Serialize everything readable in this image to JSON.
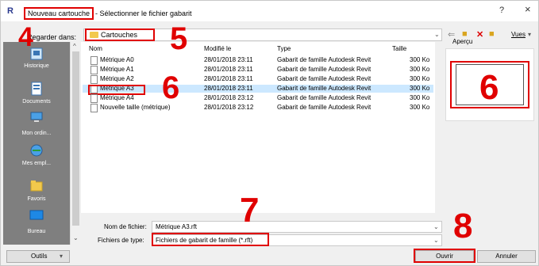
{
  "titlebar": {
    "app_icon": "R",
    "title_highlighted": "Nouveau cartouche",
    "title_rest": "- Sélectionner le fichier gabarit",
    "help": "?",
    "close": "×"
  },
  "lookin": {
    "label": "Regarder dans:",
    "value": "Cartouches"
  },
  "toolbar": {
    "views_label": "Vues",
    "icons": [
      "back-arrow-icon",
      "up-folder-icon",
      "delete-icon",
      "new-folder-icon"
    ]
  },
  "preview": {
    "label": "Aperçu"
  },
  "sidebar": {
    "items": [
      {
        "label": "Historique",
        "icon": "history-icon"
      },
      {
        "label": "Documents",
        "icon": "documents-icon"
      },
      {
        "label": "Mon ordin...",
        "icon": "computer-icon"
      },
      {
        "label": "Mes empl...",
        "icon": "network-icon"
      },
      {
        "label": "Favoris",
        "icon": "favorites-icon"
      },
      {
        "label": "Bureau",
        "icon": "desktop-icon"
      }
    ]
  },
  "file_list": {
    "columns": [
      "Nom",
      "Modifié le",
      "Type",
      "Taille"
    ],
    "rows": [
      {
        "name": "Métrique A0",
        "date": "28/01/2018 23:11",
        "type": "Gabarit de famille Autodesk Revit",
        "size": "300 Ko"
      },
      {
        "name": "Métrique A1",
        "date": "28/01/2018 23:11",
        "type": "Gabarit de famille Autodesk Revit",
        "size": "300 Ko"
      },
      {
        "name": "Métrique A2",
        "date": "28/01/2018 23:11",
        "type": "Gabarit de famille Autodesk Revit",
        "size": "300 Ko"
      },
      {
        "name": "Métrique A3",
        "date": "28/01/2018 23:11",
        "type": "Gabarit de famille Autodesk Revit",
        "size": "300 Ko"
      },
      {
        "name": "Métrique A4",
        "date": "28/01/2018 23:12",
        "type": "Gabarit de famille Autodesk Revit",
        "size": "300 Ko"
      },
      {
        "name": "Nouvelle taille (métrique)",
        "date": "28/01/2018 23:12",
        "type": "Gabarit de famille Autodesk Revit",
        "size": "300 Ko"
      }
    ],
    "selected_row": 3
  },
  "filename": {
    "label": "Nom de fichier:",
    "value": "Métrique A3.rft"
  },
  "filetype": {
    "label": "Fichiers de type:",
    "value": "Fichiers de gabarit de famille  (*.rft)"
  },
  "buttons": {
    "tools": "Outils",
    "open": "Ouvrir",
    "cancel": "Annuler"
  },
  "annotations": {
    "n4": "4",
    "n5": "5",
    "n6a": "6",
    "n6b": "6",
    "n7": "7",
    "n8": "8"
  },
  "colors": {
    "highlight": "#e00000",
    "selection": "#cce8ff",
    "sidebar": "#7f7f7f"
  }
}
